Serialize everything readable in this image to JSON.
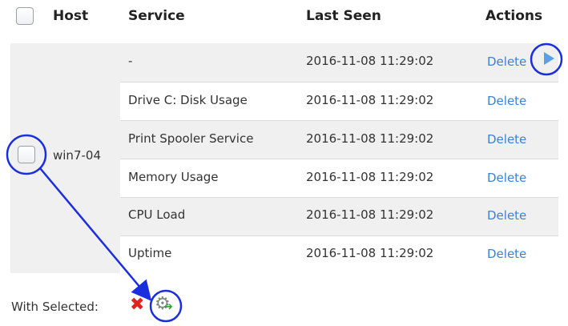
{
  "header": {
    "host": "Host",
    "service": "Service",
    "last_seen": "Last Seen",
    "actions": "Actions"
  },
  "host": {
    "name": "win7-04"
  },
  "rows": [
    {
      "service": "-",
      "last_seen": "2016-11-08 11:29:02",
      "action": "Delete"
    },
    {
      "service": "Drive C: Disk Usage",
      "last_seen": "2016-11-08 11:29:02",
      "action": "Delete"
    },
    {
      "service": "Print Spooler Service",
      "last_seen": "2016-11-08 11:29:02",
      "action": "Delete"
    },
    {
      "service": "Memory Usage",
      "last_seen": "2016-11-08 11:29:02",
      "action": "Delete"
    },
    {
      "service": "CPU Load",
      "last_seen": "2016-11-08 11:29:02",
      "action": "Delete"
    },
    {
      "service": "Uptime",
      "last_seen": "2016-11-08 11:29:02",
      "action": "Delete"
    }
  ],
  "footer": {
    "with_selected": "With Selected:"
  },
  "icons": {
    "expand": "play-icon",
    "bulk_delete": "red-x-icon",
    "bulk_action": "gear-icon"
  },
  "colors": {
    "link": "#3b82d6",
    "annotation": "#1a2ee0",
    "row_alt": "#f0f0f0",
    "delete_x": "#e0231c"
  }
}
